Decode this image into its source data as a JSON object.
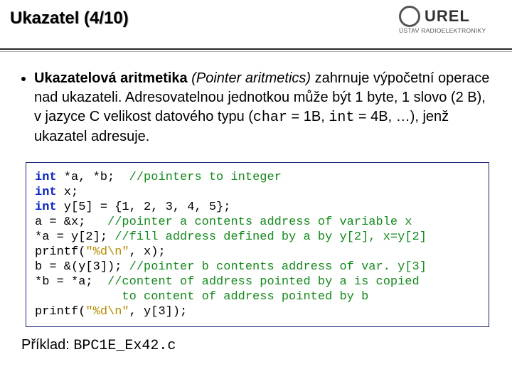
{
  "header": {
    "title": "Ukazatel (4/10)",
    "logo_text": "UREL",
    "logo_sub": "ÚSTAV RADIOELEKTRONIKY"
  },
  "bullet": {
    "strong1": "Ukazatelová aritmetika",
    "italic1": "(Pointer aritmetics)",
    "rest": " zahrnuje výpočetní operace nad ukazateli. Adresovatelnou jednotkou může být    1 byte, 1 slovo (2 B), v jazyce C velikost datového typu (",
    "code1": "char",
    "mid1": " = 1B, ",
    "code2": "int",
    "mid2": " = 4B, …), jenž ukazatel adresuje."
  },
  "code": {
    "l1a": "int",
    "l1b": " *a, *b;  ",
    "l1c": "//pointers to integer",
    "l2a": "int",
    "l2b": " x;",
    "l3a": "int",
    "l3b": " y[5] = {1, 2, 3, 4, 5};",
    "l4a": "a = &x;   ",
    "l4b": "//pointer a contents address of variable x",
    "l5a": "*a = y[2]; ",
    "l5b": "//fill address defined by a by y[2], x=y[2]",
    "l6a": "printf(",
    "l6b": "\"%d\\n\"",
    "l6c": ", x);",
    "l7a": "b = &(y[3]); ",
    "l7b": "//pointer b contents address of var. y[3]",
    "l8a": "*b = *a;  ",
    "l8b": "//content of address pointed by a is copied",
    "l9": "            to content of address pointed by b",
    "l10a": "printf(",
    "l10b": "\"%d\\n\"",
    "l10c": ", y[3]);"
  },
  "example": {
    "label": "Příklad: ",
    "file": "BPC1E_Ex42.c"
  }
}
